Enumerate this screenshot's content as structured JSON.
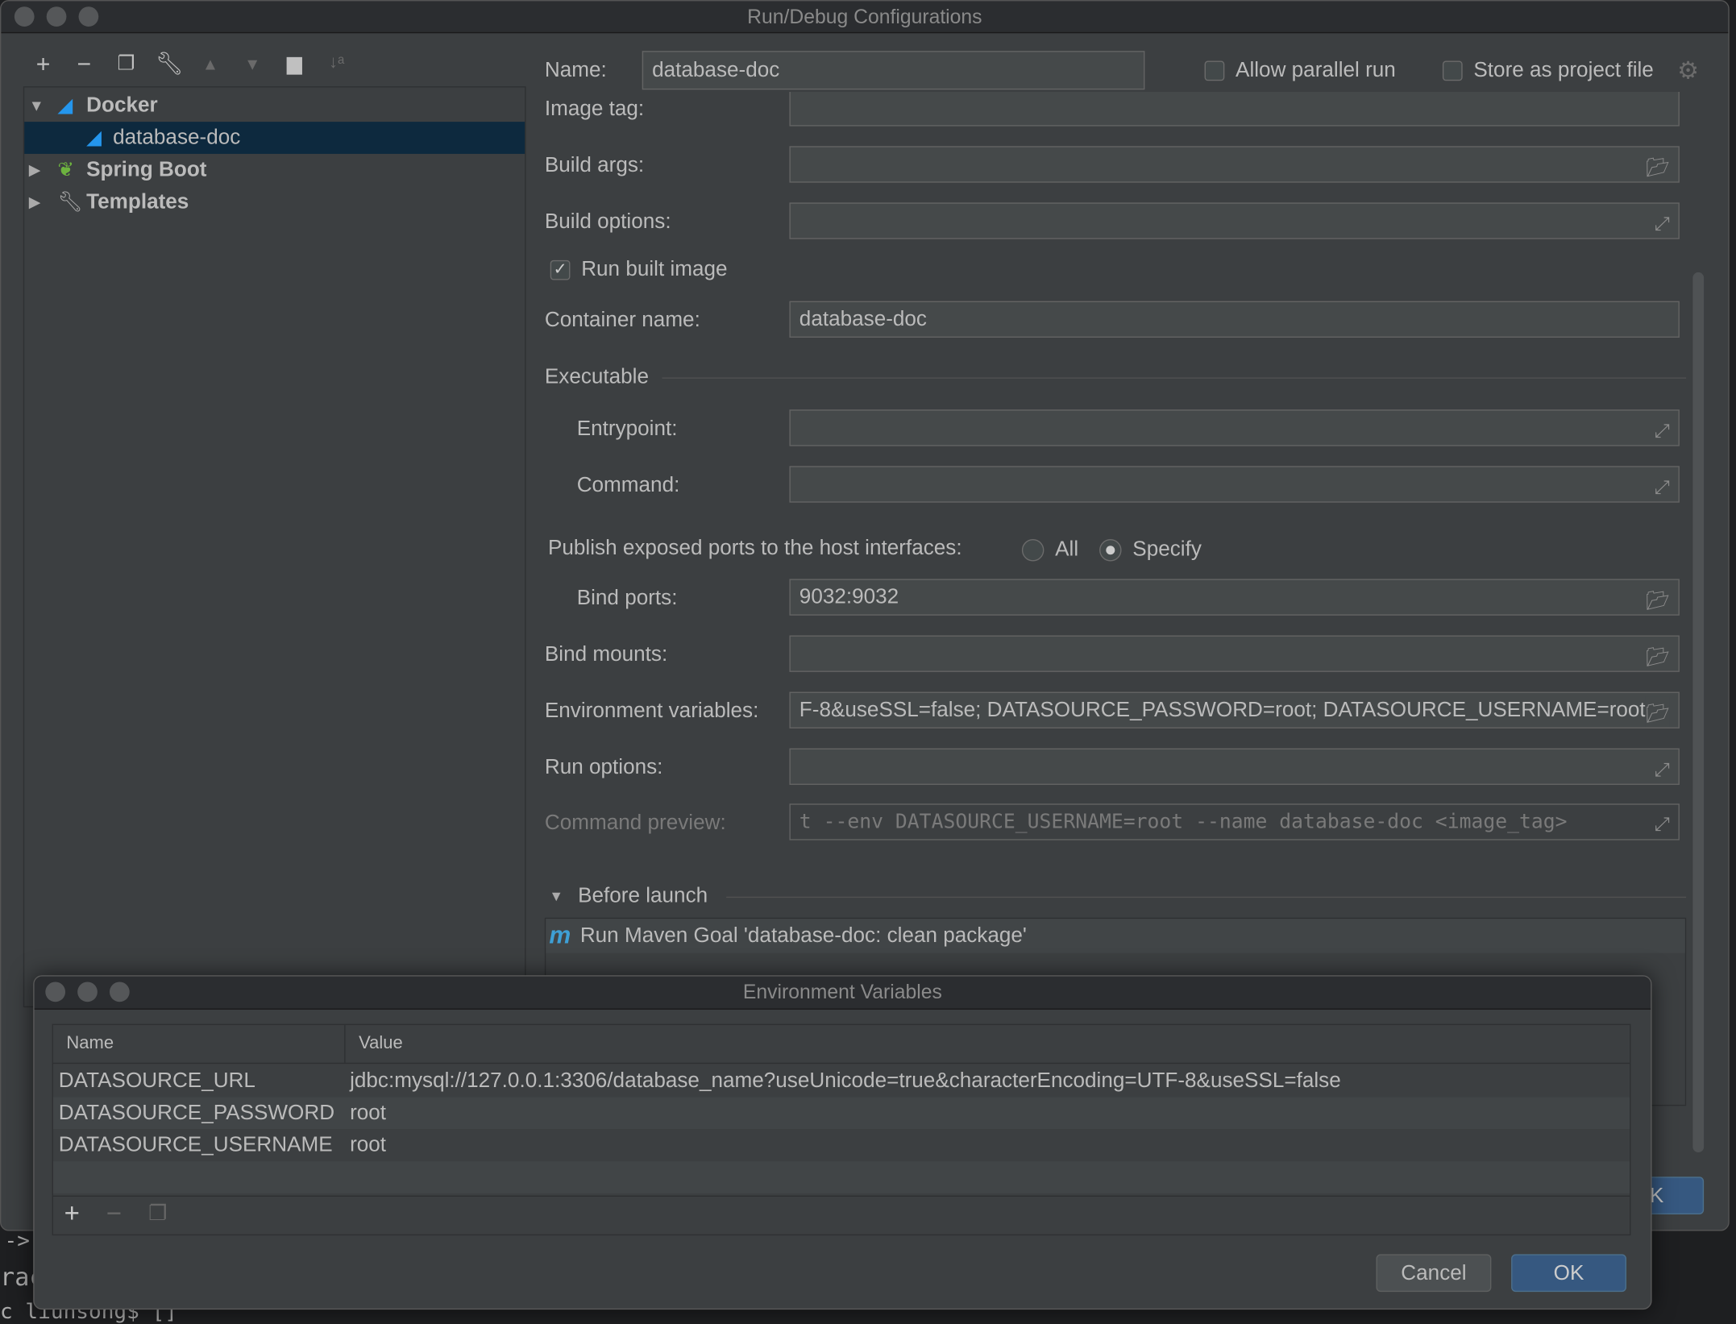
{
  "window": {
    "title": "Run/Debug Configurations"
  },
  "toolbar": {
    "icons": [
      "add-icon",
      "remove-icon",
      "copy-icon",
      "wrench-icon",
      "move-up-icon",
      "move-down-icon",
      "new-folder-icon",
      "sort-icon"
    ]
  },
  "tree": {
    "items": [
      {
        "label": "Docker",
        "expanded": true
      },
      {
        "label": "database-doc",
        "selected": true
      },
      {
        "label": "Spring Boot",
        "expanded": false
      },
      {
        "label": "Templates",
        "expanded": false
      }
    ]
  },
  "header": {
    "name_label": "Name:",
    "name_value": "database-doc",
    "allow_parallel": "Allow parallel run",
    "store_project": "Store as project file"
  },
  "form": {
    "image_tag_label": "Image tag:",
    "build_args_label": "Build args:",
    "build_options_label": "Build options:",
    "run_built_image": "Run built image",
    "container_name_label": "Container name:",
    "container_name_value": "database-doc",
    "executable_label": "Executable",
    "entrypoint_label": "Entrypoint:",
    "command_label": "Command:",
    "publish_label": "Publish exposed ports to the host interfaces:",
    "radio_all": "All",
    "radio_specify": "Specify",
    "bind_ports_label": "Bind ports:",
    "bind_ports_value": "9032:9032",
    "bind_mounts_label": "Bind mounts:",
    "env_label": "Environment variables:",
    "env_value": "F-8&useSSL=false; DATASOURCE_PASSWORD=root; DATASOURCE_USERNAME=root",
    "run_options_label": "Run options:",
    "preview_label": "Command preview:",
    "preview_value": "t --env DATASOURCE_USERNAME=root --name database-doc <image_tag>",
    "before_launch_label": "Before launch",
    "before_launch_item": "Run Maven Goal 'database-doc: clean package'"
  },
  "behind_ok": "K",
  "terminal": {
    "lines": [
      "->",
      "rac",
      "c liuhsong$ []"
    ]
  },
  "env_dialog": {
    "title": "Environment Variables",
    "columns": [
      "Name",
      "Value"
    ],
    "rows": [
      {
        "name": "DATASOURCE_URL",
        "value": "jdbc:mysql://127.0.0.1:3306/database_name?useUnicode=true&characterEncoding=UTF-8&useSSL=false"
      },
      {
        "name": "DATASOURCE_PASSWORD",
        "value": "root"
      },
      {
        "name": "DATASOURCE_USERNAME",
        "value": "root"
      }
    ],
    "cancel": "Cancel",
    "ok": "OK"
  },
  "colors": {
    "background": "#3c3f41",
    "selection": "#0d293e",
    "accent_button": "#365880",
    "docker_blue": "#2496ed",
    "spring_green": "#6db33f"
  }
}
